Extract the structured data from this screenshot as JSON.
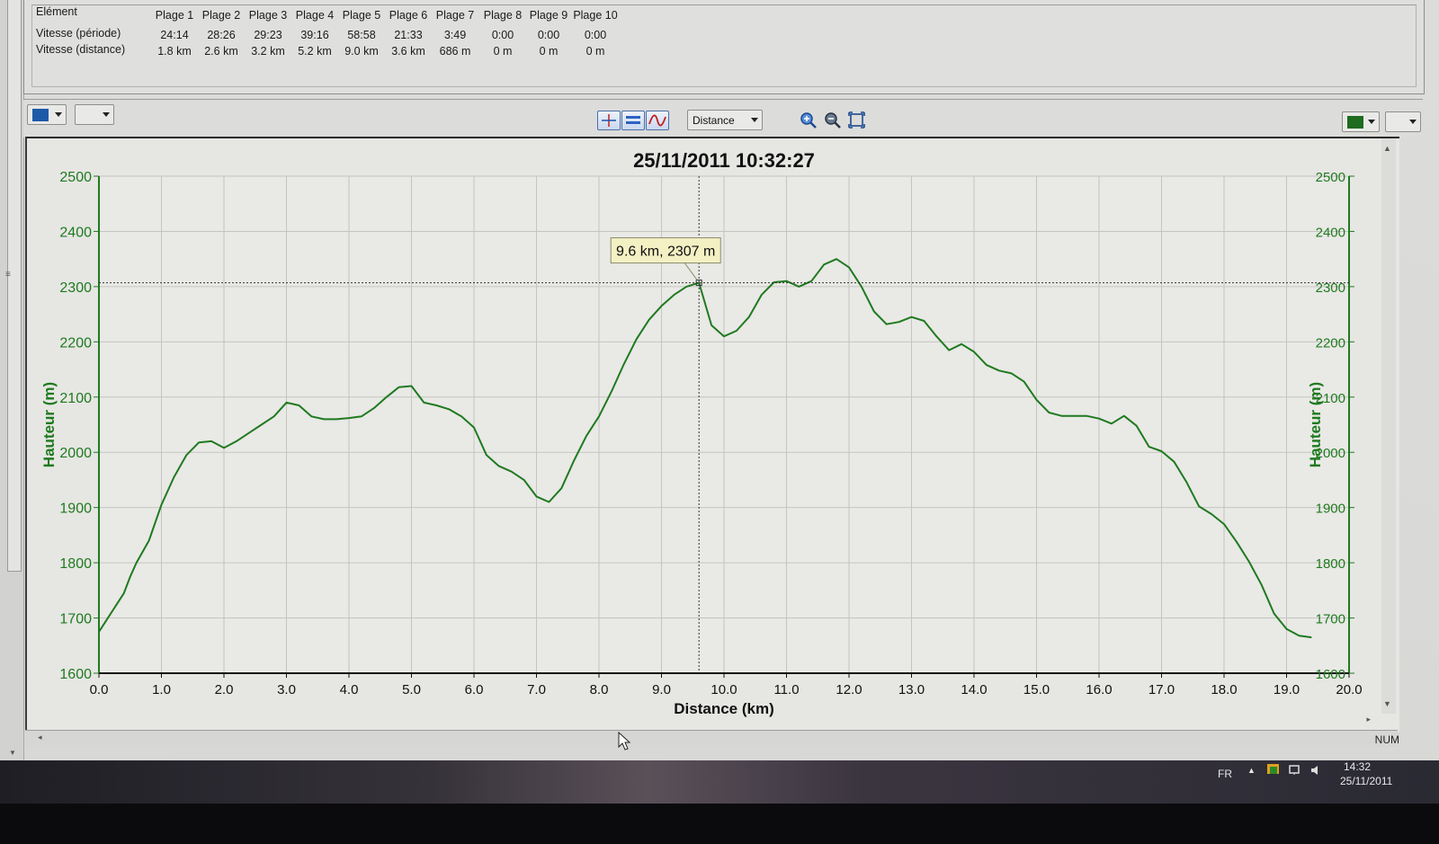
{
  "stats_table": {
    "headers": [
      "Elément",
      "Plage 1",
      "Plage 2",
      "Plage 3",
      "Plage 4",
      "Plage 5",
      "Plage 6",
      "Plage 7",
      "Plage 8",
      "Plage 9",
      "Plage 10"
    ],
    "rows": [
      {
        "label": "Vitesse (période)",
        "values": [
          "24:14",
          "28:26",
          "29:23",
          "39:16",
          "58:58",
          "21:33",
          "3:49",
          "0:00",
          "0:00",
          "0:00"
        ]
      },
      {
        "label": "Vitesse (distance)",
        "values": [
          "1.8 km",
          "2.6 km",
          "3.2 km",
          "5.2 km",
          "9.0 km",
          "3.6 km",
          "686 m",
          "0 m",
          "0 m",
          "0 m"
        ]
      }
    ]
  },
  "toolbar": {
    "left_color": "#1d5aa8",
    "right_color": "#1f6b1f",
    "x_axis_select": "Distance",
    "tool_buttons": [
      "crosshair-icon",
      "band-icon",
      "curve-icon"
    ],
    "zoom_icons": [
      "zoom-in-icon",
      "zoom-out-icon",
      "fit-icon"
    ]
  },
  "chart": {
    "title": "25/11/2011 10:32:27",
    "xlabel": "Distance (km)",
    "ylabel": "Hauteur (m)",
    "ylabel_right": "Hauteur (m)",
    "tooltip": "9.6 km, 2307 m",
    "line_color": "#1f7a1f"
  },
  "chart_data": {
    "type": "line",
    "title": "25/11/2011 10:32:27",
    "xlabel": "Distance (km)",
    "ylabel": "Hauteur (m)",
    "xlim": [
      0,
      20
    ],
    "ylim": [
      1600,
      2500
    ],
    "xticks": [
      "0.0",
      "1.0",
      "2.0",
      "3.0",
      "4.0",
      "5.0",
      "6.0",
      "7.0",
      "8.0",
      "9.0",
      "10.0",
      "11.0",
      "12.0",
      "13.0",
      "14.0",
      "15.0",
      "16.0",
      "17.0",
      "18.0",
      "19.0",
      "20.0"
    ],
    "yticks": [
      "1600",
      "1700",
      "1800",
      "1900",
      "2000",
      "2100",
      "2200",
      "2300",
      "2400",
      "2500"
    ],
    "grid": true,
    "cursor_point": {
      "x": 9.6,
      "y": 2307
    },
    "x": [
      0,
      0.2,
      0.4,
      0.5,
      0.6,
      0.8,
      1.0,
      1.2,
      1.4,
      1.6,
      1.8,
      2.0,
      2.2,
      2.4,
      2.6,
      2.8,
      3.0,
      3.2,
      3.4,
      3.6,
      3.8,
      4.0,
      4.2,
      4.4,
      4.6,
      4.8,
      5.0,
      5.2,
      5.4,
      5.6,
      5.8,
      6.0,
      6.2,
      6.4,
      6.6,
      6.8,
      7.0,
      7.2,
      7.4,
      7.6,
      7.8,
      8.0,
      8.2,
      8.4,
      8.6,
      8.8,
      9.0,
      9.2,
      9.4,
      9.6,
      9.8,
      10.0,
      10.2,
      10.4,
      10.6,
      10.8,
      11.0,
      11.2,
      11.4,
      11.6,
      11.8,
      12.0,
      12.2,
      12.4,
      12.6,
      12.8,
      13.0,
      13.2,
      13.4,
      13.6,
      13.8,
      14.0,
      14.2,
      14.4,
      14.6,
      14.8,
      15.0,
      15.2,
      15.4,
      15.6,
      15.8,
      16.0,
      16.2,
      16.4,
      16.6,
      16.8,
      17.0,
      17.2,
      17.4,
      17.6,
      17.8,
      18.0,
      18.2,
      18.4,
      18.6,
      18.8,
      19.0,
      19.2,
      19.4
    ],
    "y": [
      1675,
      1710,
      1745,
      1775,
      1800,
      1840,
      1905,
      1955,
      1995,
      2018,
      2020,
      2008,
      2020,
      2035,
      2050,
      2065,
      2090,
      2085,
      2065,
      2060,
      2060,
      2062,
      2065,
      2080,
      2100,
      2118,
      2120,
      2090,
      2085,
      2078,
      2065,
      2045,
      1995,
      1975,
      1965,
      1950,
      1920,
      1910,
      1935,
      1985,
      2030,
      2065,
      2110,
      2160,
      2205,
      2240,
      2265,
      2285,
      2300,
      2307,
      2230,
      2210,
      2220,
      2245,
      2285,
      2308,
      2310,
      2300,
      2310,
      2340,
      2350,
      2335,
      2300,
      2255,
      2232,
      2236,
      2245,
      2238,
      2210,
      2185,
      2196,
      2182,
      2158,
      2148,
      2143,
      2128,
      2095,
      2072,
      2066,
      2066,
      2066,
      2061,
      2052,
      2066,
      2048,
      2010,
      2002,
      1983,
      1946,
      1902,
      1888,
      1870,
      1838,
      1802,
      1760,
      1708,
      1680,
      1668,
      1665
    ]
  },
  "status_bar": {
    "num": "NUM"
  },
  "taskbar": {
    "lang": "FR",
    "time": "14:32",
    "date": "25/11/2011"
  }
}
